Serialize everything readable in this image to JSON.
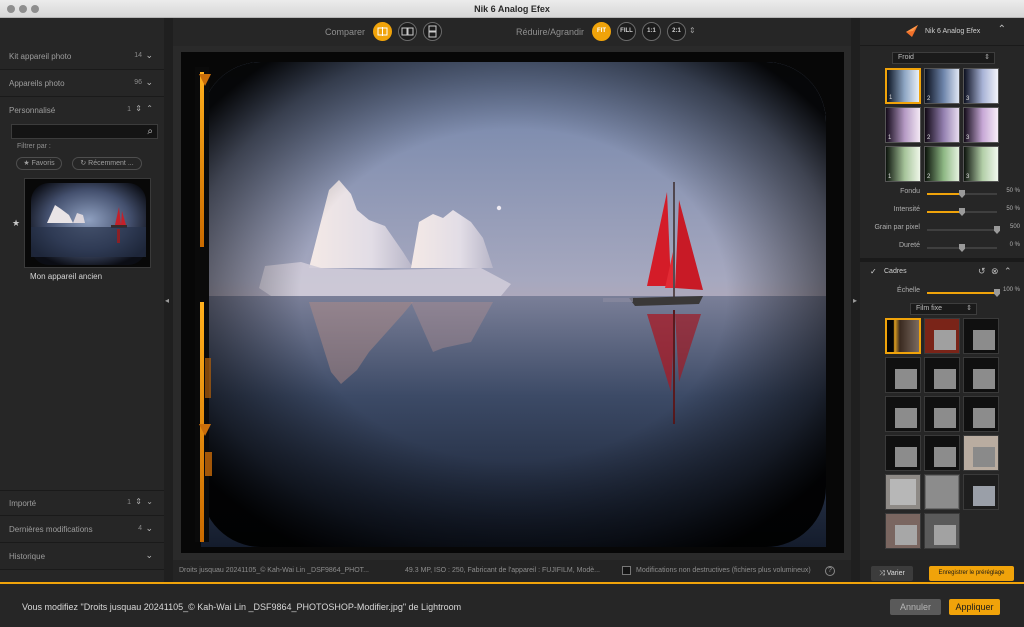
{
  "window": {
    "title": "Nik 6 Analog Efex"
  },
  "left_panel": {
    "sections_top": [
      {
        "label": "Kit appareil photo",
        "count": "14"
      },
      {
        "label": "Appareils photo",
        "count": "96"
      },
      {
        "label": "Personnalisé",
        "count": "1"
      }
    ],
    "search": {
      "placeholder": ""
    },
    "filter_label": "Filtrer par :",
    "filter_favorites": "★ Favoris",
    "filter_recent": "↻ Récemment ...",
    "thumbnail_name": "Mon appareil ancien",
    "sections_bottom": [
      {
        "label": "Importé",
        "count": "1"
      },
      {
        "label": "Dernières modifications",
        "count": "4"
      },
      {
        "label": "Historique",
        "count": ""
      }
    ]
  },
  "toolbar": {
    "compare_label": "Comparer",
    "zoom_label": "Réduire/Agrandir",
    "zoom_buttons": [
      "FIT",
      "FILL",
      "1:1",
      "2:1"
    ]
  },
  "statusbar": {
    "file": "Droits jusquau 20241105_© Kah-Wai Lin _DSF9864_PHOT...",
    "meta": "49.3 MP, ISO : 250, Fabricant de l'appareil : FUJIFILM, Modè...",
    "nondestructive": "Modifications non destructives (fichiers plus volumineux)",
    "help": "?"
  },
  "right_panel": {
    "product_name": "Nik 6 Analog Efex",
    "tone_select": "Froid",
    "preset_numbers": [
      "1",
      "2",
      "3",
      "1",
      "2",
      "3",
      "1",
      "2",
      "3"
    ],
    "sliders": [
      {
        "label": "Fondu",
        "value": 50,
        "display": "50 %"
      },
      {
        "label": "Intensité",
        "value": 50,
        "display": "50 %"
      },
      {
        "label": "Grain par pixel",
        "value": 100,
        "display": "500"
      },
      {
        "label": "Dureté",
        "value": 50,
        "display": "0 %"
      }
    ],
    "frames_label": "Cadres",
    "frames_check": "✓",
    "scale_label": "Échelle",
    "scale_value": 100,
    "scale_display": "100 %",
    "frame_type": "Film fixe",
    "vary_button": "Varier",
    "save_preset_button": "Enregistrer le préréglage"
  },
  "bottom_bar": {
    "message": "Vous modifiez \"Droits jusquau 20241105_© Kah-Wai Lin _DSF9864_PHOTOSHOP-Modifier.jpg\" de Lightroom",
    "cancel_button": "Annuler",
    "apply_button": "Appliquer"
  },
  "colors": {
    "accent": "#f0a30a"
  }
}
